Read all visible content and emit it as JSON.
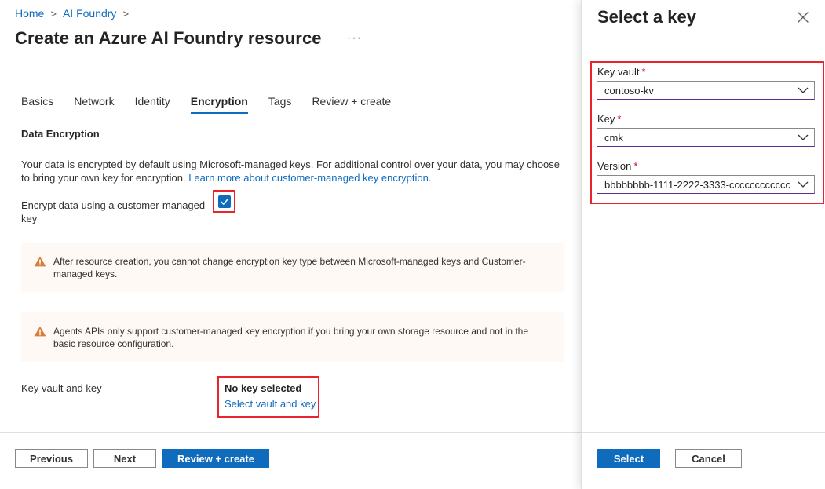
{
  "breadcrumb": {
    "home": "Home",
    "foundry": "AI Foundry",
    "sep": ">"
  },
  "page": {
    "title": "Create an Azure AI Foundry resource",
    "more": "···"
  },
  "tabs": [
    {
      "label": "Basics"
    },
    {
      "label": "Network"
    },
    {
      "label": "Identity"
    },
    {
      "label": "Encryption",
      "active": true
    },
    {
      "label": "Tags"
    },
    {
      "label": "Review + create"
    }
  ],
  "encryption": {
    "section_title": "Data Encryption",
    "description": "Your data is encrypted by default using Microsoft-managed keys. For additional control over your data, you may choose to bring your own key for encryption.",
    "learn_more": "Learn more about customer-managed key encryption.",
    "checkbox_label": "Encrypt data using a customer-managed key",
    "checkbox_checked": true,
    "warning1": "After resource creation, you cannot change encryption key type between Microsoft-managed keys and Customer-managed keys.",
    "warning2": "Agents APIs only support customer-managed key encryption if you bring your own storage resource and not in the basic resource configuration.",
    "kv_label": "Key vault and key",
    "no_key": "No key selected",
    "select_link": "Select vault and key"
  },
  "footer": {
    "previous": "Previous",
    "next": "Next",
    "review": "Review + create"
  },
  "panel": {
    "title": "Select a key",
    "key_vault_label": "Key vault",
    "key_vault_value": "contoso-kv",
    "key_label": "Key",
    "key_value": "cmk",
    "version_label": "Version",
    "version_value": "bbbbbbbb-1111-2222-3333-cccccccccccc",
    "required_mark": "*",
    "select_btn": "Select",
    "cancel_btn": "Cancel"
  },
  "colors": {
    "accent": "#0f6cbd",
    "highlight": "#e8242c",
    "warning": "#d67f3c",
    "required": "#c50f1f"
  },
  "icons": [
    "chevron-right-icon",
    "more-icon",
    "check-icon",
    "warning-icon",
    "chevron-down-icon",
    "close-icon"
  ]
}
